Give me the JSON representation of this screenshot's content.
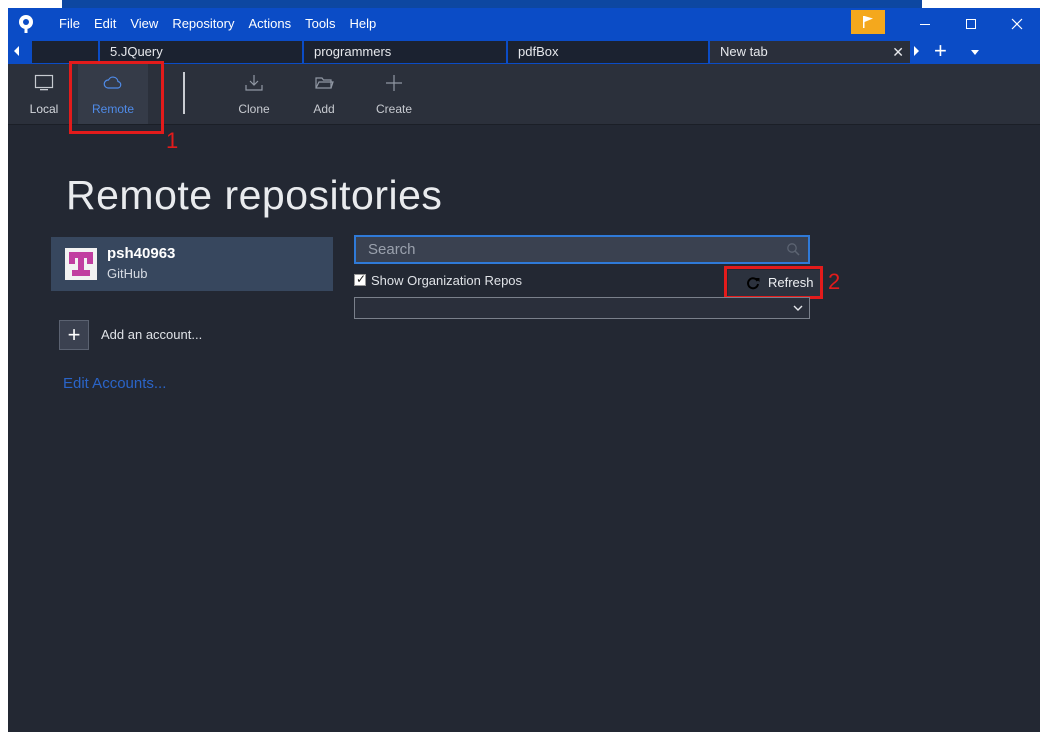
{
  "menubar": {
    "items": [
      "File",
      "Edit",
      "View",
      "Repository",
      "Actions",
      "Tools",
      "Help"
    ],
    "accent": "#0b4cc6",
    "flag_color": "#f4a81d"
  },
  "tabs": [
    {
      "label": ""
    },
    {
      "label": "5.JQuery"
    },
    {
      "label": "programmers"
    },
    {
      "label": "pdfBox"
    },
    {
      "label": "New tab",
      "active": true,
      "close": "✕"
    }
  ],
  "tabbar": {
    "add": "+"
  },
  "toolbar": {
    "local": "Local",
    "remote": "Remote",
    "clone": "Clone",
    "add": "Add",
    "create": "Create"
  },
  "annotations": {
    "one": "1",
    "two": "2",
    "color": "#e31b1b"
  },
  "main": {
    "title": "Remote repositories",
    "account": {
      "name": "psh40963",
      "type": "GitHub"
    },
    "add_account": {
      "icon": "+",
      "label": "Add an account..."
    },
    "edit_accounts": "Edit Accounts...",
    "search": {
      "placeholder": "Search"
    },
    "show_org": {
      "label": "Show Organization Repos",
      "checked": true
    },
    "refresh": "Refresh",
    "repo_select": {
      "value": ""
    }
  }
}
